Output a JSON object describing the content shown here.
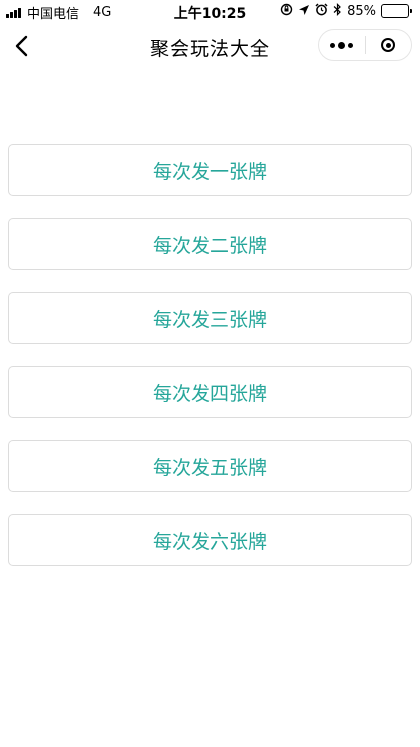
{
  "status_bar": {
    "carrier": "中国电信",
    "network": "4G",
    "time": "上午10:25",
    "battery_percent": "85%",
    "battery_level": 0.85,
    "battery_color": "#4cd964",
    "icons": [
      "signal-icon",
      "orientation-lock-icon",
      "location-icon",
      "alarm-icon",
      "bluetooth-icon",
      "battery-icon"
    ]
  },
  "nav": {
    "title": "聚会玩法大全",
    "back_icon": "back-arrow-icon",
    "more_icon": "more-icon",
    "close_icon": "close-miniprogram-icon"
  },
  "options": [
    {
      "label": "每次发一张牌"
    },
    {
      "label": "每次发二张牌"
    },
    {
      "label": "每次发三张牌"
    },
    {
      "label": "每次发四张牌"
    },
    {
      "label": "每次发五张牌"
    },
    {
      "label": "每次发六张牌"
    }
  ],
  "colors": {
    "accent": "#26a69a",
    "border": "#dcdcdc"
  }
}
